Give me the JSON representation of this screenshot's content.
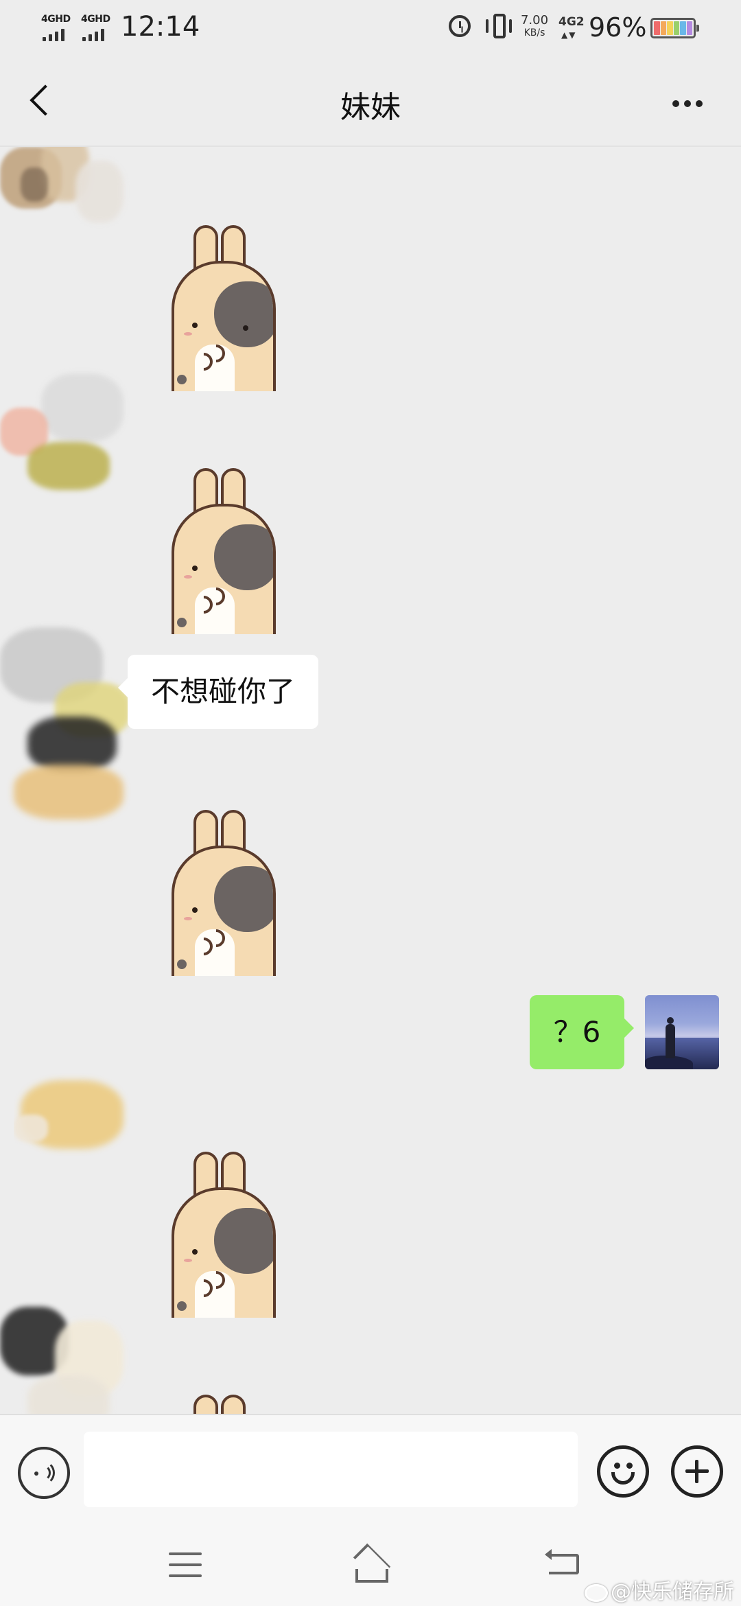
{
  "status_bar": {
    "signal_1": "4GHD",
    "signal_2": "4GHD",
    "time": "12:14",
    "net_speed_value": "7.00",
    "net_speed_unit": "KB/s",
    "network_type": "4G2",
    "battery_percent": "96%",
    "battery_level": 0.96,
    "icons": [
      "alarm-icon",
      "vibrate-icon",
      "battery-icon"
    ]
  },
  "header": {
    "title": "妹妹",
    "back_icon": "chevron-left-icon",
    "more_icon": "more-horizontal-icon"
  },
  "messages": [
    {
      "sender": "contact",
      "type": "sticker",
      "sticker": "bunny"
    },
    {
      "sender": "contact",
      "type": "sticker",
      "sticker": "bunny"
    },
    {
      "sender": "contact",
      "type": "text",
      "text": "不想碰你了"
    },
    {
      "sender": "contact",
      "type": "sticker",
      "sticker": "bunny"
    },
    {
      "sender": "me",
      "type": "text",
      "text": "？6"
    },
    {
      "sender": "contact",
      "type": "sticker",
      "sticker": "bunny"
    },
    {
      "sender": "contact",
      "type": "sticker",
      "sticker": "bunny"
    }
  ],
  "colors": {
    "background": "#ededed",
    "my_bubble": "#95ec69",
    "their_bubble": "#ffffff"
  },
  "input_bar": {
    "message_value": "",
    "icons": [
      "voice-icon",
      "emoji-icon",
      "plus-icon"
    ]
  },
  "nav_bar": {
    "icons": [
      "menu-icon",
      "home-icon",
      "back-icon"
    ]
  },
  "watermark": "@快乐储存所"
}
